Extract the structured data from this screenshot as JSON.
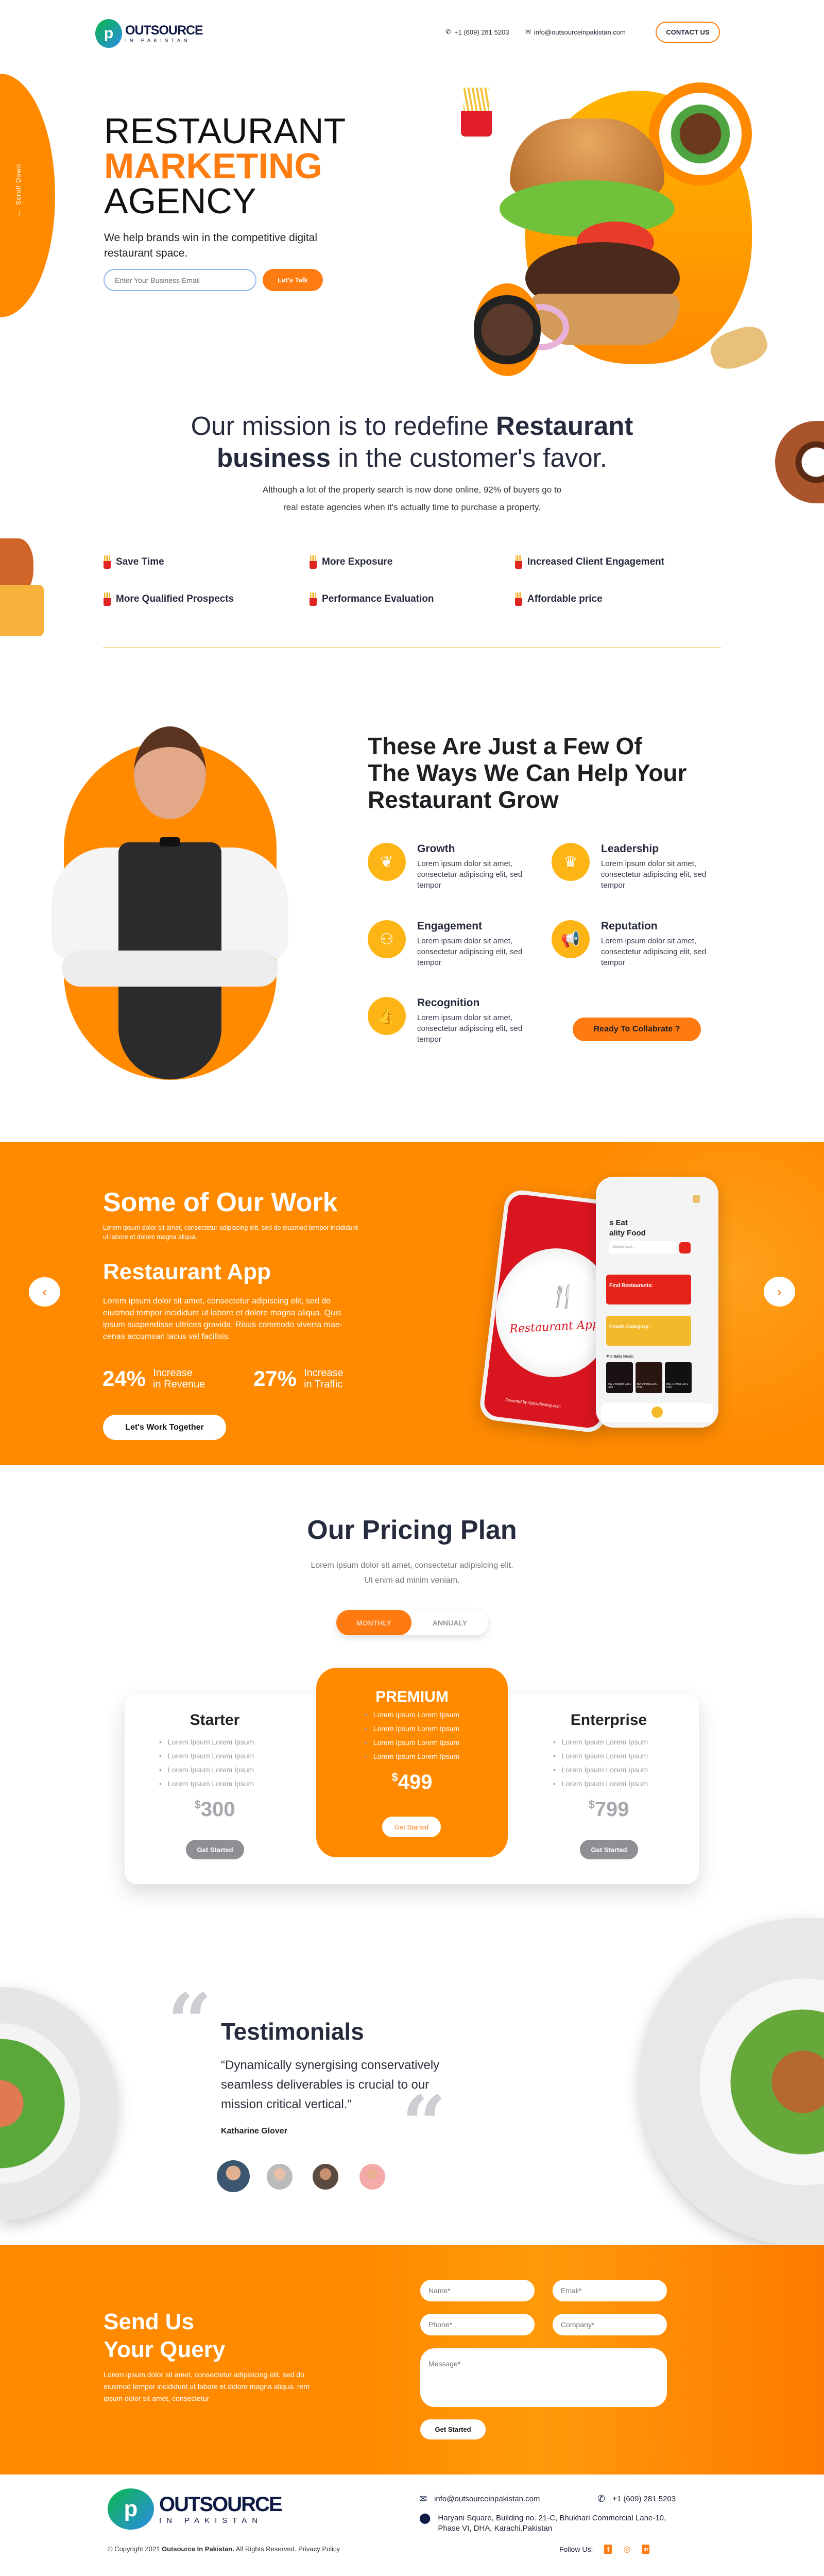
{
  "header": {
    "logo_main": "OUTSOURCE",
    "logo_sub": "IN PAKISTAN",
    "phone": "+1 (609) 281 5203",
    "email": "info@outsourceinpakistan.com",
    "contact_label": "CONTACT US"
  },
  "hero": {
    "scroll_label": "Scroll Down",
    "title_line1": "RESTAURANT",
    "title_line2": "MARKETING",
    "title_line3": "AGENCY",
    "subtitle": "We help brands win in the competitive digital restaurant space.",
    "email_placeholder": "Enter Your Business Email",
    "cta": "Let's Talk"
  },
  "mission": {
    "pre": "Our mission is to redefine ",
    "bold1": "Restaurant",
    "bold2": "business",
    "post": " in the customer's favor.",
    "paragraph_line1": "Although a lot of the property search is now done online, 92% of buyers go to",
    "paragraph_line2": "real estate agencies when it's actually time to purchase a property."
  },
  "features": [
    "Save Time",
    "More Exposure",
    "Increased Client Engagement",
    "More Qualified Prospects",
    "Performance Evaluation",
    "Affordable price"
  ],
  "help": {
    "heading_line1": "These Are Just a Few Of",
    "heading_line2": "The Ways We Can Help Your",
    "heading_line3": "Restaurant Grow",
    "items": [
      {
        "title": "Growth",
        "text": "Lorem ipsum dolor sit amet, consectetur adipiscing elit, sed tempor"
      },
      {
        "title": "Leadership",
        "text": "Lorem ipsum dolor sit amet, consectetur adipiscing elit, sed tempor"
      },
      {
        "title": "Engagement",
        "text": "Lorem ipsum dolor sit amet, consectetur adipiscing elit, sed tempor"
      },
      {
        "title": "Reputation",
        "text": "Lorem ipsum dolor sit amet, consectetur adipiscing elit, sed tempor"
      },
      {
        "title": "Recognition",
        "text": "Lorem ipsum dolor sit amet, consectetur adipiscing elit, sed tempor"
      }
    ],
    "cta": "Ready To Collabrate ?"
  },
  "work": {
    "title": "Some of Our Work",
    "subtitle": "Lorem ipsum dolor sit amet, consectetur adipiscing elit, sed do eiusmod tempor incididunt ut labore et dolore magna aliqua.",
    "project_title": "Restaurant App",
    "description": "Lorem ipsum dolor sit amet, consectetur adipiscing elit, sed do eiusmod tempor incididunt ut labore et dolore magna aliqua. Quis ipsum suspendisse ultrices gravida. Risus commodo viverra mae-cenas accumsan lacus vel facilisis.",
    "stats": [
      {
        "value": "24%",
        "label1": "Increase",
        "label2": "in Revenue"
      },
      {
        "value": "27%",
        "label1": "Increase",
        "label2": "in Traffic"
      }
    ],
    "cta": "Let's Work Together",
    "mockup": {
      "splash_logo": "Restaurant App",
      "splash_footer": "Powered by Appsaberling.com",
      "headline1": "s Eat",
      "headline2": "ality Food",
      "search": "Search food...",
      "find": "Find Restaurants:",
      "category": "Foods Category:",
      "deals": "The Daily Deals:",
      "deal_items": [
        "Buy 2 Burgers Get 1 Free",
        "Buy 2 Pizza Get 1 Free",
        "Buy 2 Drinks Get 1 Free"
      ]
    }
  },
  "pricing": {
    "title": "Our Pricing Plan",
    "subtitle_line1": "Lorem ipsum dolor sit amet, consectetur adipisicing elit.",
    "subtitle_line2": "Ut enim ad minim veniam.",
    "toggle": [
      "MONTHLY",
      "ANNUALY"
    ],
    "plans": [
      {
        "name": "Starter",
        "features": [
          "Lorem Ipsum Lorem Ipsum",
          "Lorem Ipsum Lorem Ipsum",
          "Lorem Ipsum Lorem Ipsum",
          "Lorem Ipsum Lorem Ipsum"
        ],
        "currency": "$",
        "price": "300",
        "cta": "Get Started"
      },
      {
        "name": "PREMIUM",
        "features": [
          "Lorem Ipsum Lorem Ipsum",
          "Lorem Ipsum Lorem Ipsum",
          "Lorem Ipsum Lorem Ipsum",
          "Lorem Ipsum Lorem Ipsum"
        ],
        "currency": "$",
        "price": "499",
        "cta": "Get Started"
      },
      {
        "name": "Enterprise",
        "features": [
          "Lorem Ipsum Lorem Ipsum",
          "Lorem Ipsum Lorem Ipsum",
          "Lorem Ipsum Lorem Ipsum",
          "Lorem Ipsum Lorem Ipsum"
        ],
        "currency": "$",
        "price": "799",
        "cta": "Get Started"
      }
    ]
  },
  "testimonials": {
    "title": "Testimonials",
    "quote": "“Dynamically synergising conservatively seamless deliverables is crucial to our mission critical vertical.”",
    "author": "Katharine Glover"
  },
  "contact": {
    "title_line1": "Send Us",
    "title_line2": "Your Query",
    "paragraph": "Lorem ipsum dolor sit amet, consectetur adipisicing elit, sed do eiusmod tempor incididunt ut labore et dolore magna aliqua. rem ipsum dolor sit amet, consectetur",
    "name_placeholder": "Name*",
    "email_placeholder": "Email*",
    "phone_placeholder": "Phone*",
    "company_placeholder": "Company*",
    "message_placeholder": "Message*",
    "submit": "Get Started"
  },
  "footer": {
    "email": "info@outsourceinpakistan.com",
    "phone": "+1 (609) 281 5203",
    "address_line1": "Haryani Square, Building no. 21-C, Bhukhari Commercial Lane-10,",
    "address_line2": "Phase VI, DHA, Karachi.Pakistan",
    "copyright_pre": "© Copyright 2021 ",
    "copyright_brand": "Outsource In Pakistan.",
    "copyright_post": " All Rights Reserved. Privacy Policy",
    "follow": "Follow Us:",
    "social": [
      {
        "name": "facebook",
        "glyph": "f"
      },
      {
        "name": "instagram",
        "glyph": "◎"
      },
      {
        "name": "linkedin",
        "glyph": "in"
      }
    ]
  },
  "colors": {
    "orange": "#ff8a00",
    "button_orange": "#ff7d10",
    "icon_yellow": "#fdb515",
    "navy": "#1f2235"
  }
}
